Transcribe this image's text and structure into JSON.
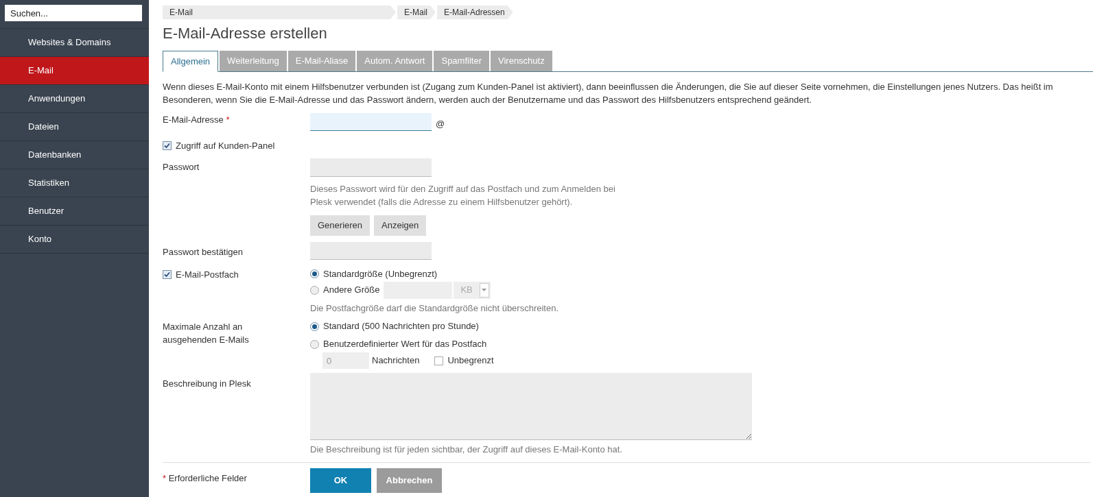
{
  "search": {
    "placeholder": "Suchen..."
  },
  "sidebar": {
    "items": [
      {
        "label": "Websites & Domains",
        "selected": false
      },
      {
        "label": "E-Mail",
        "selected": true
      },
      {
        "label": "Anwendungen",
        "selected": false
      },
      {
        "label": "Dateien",
        "selected": false
      },
      {
        "label": "Datenbanken",
        "selected": false
      },
      {
        "label": "Statistiken",
        "selected": false
      },
      {
        "label": "Benutzer",
        "selected": false
      },
      {
        "label": "Konto",
        "selected": false
      }
    ]
  },
  "breadcrumbs": [
    "E-Mail",
    "E-Mail",
    "E-Mail-Adressen"
  ],
  "title": "E-Mail-Adresse erstellen",
  "tabs": [
    {
      "label": "Allgemein",
      "selected": true
    },
    {
      "label": "Weiterleitung",
      "selected": false
    },
    {
      "label": "E-Mail-Aliase",
      "selected": false
    },
    {
      "label": "Autom. Antwort",
      "selected": false
    },
    {
      "label": "Spamfilter",
      "selected": false
    },
    {
      "label": "Virenschutz",
      "selected": false
    }
  ],
  "intro": "Wenn dieses E-Mail-Konto mit einem Hilfsbenutzer verbunden ist (Zugang zum Kunden-Panel ist aktiviert), dann beeinflussen die Änderungen, die Sie auf dieser Seite vornehmen, die Einstellungen jenes Nutzers. Das heißt im Besonderen, wenn Sie die E-Mail-Adresse und das Passwort ändern, werden auch der Benutzername und das Passwort des Hilfsbenutzers entsprechend geändert.",
  "form": {
    "email": {
      "label": "E-Mail-Adresse",
      "required_mark": "*",
      "suffix": "@"
    },
    "panel_access": {
      "label": "Zugriff auf Kunden-Panel",
      "checked": true
    },
    "password": {
      "label": "Passwort",
      "hint": "Dieses Passwort wird für den Zugriff auf das Postfach und zum Anmelden bei Plesk verwendet (falls die Adresse zu einem Hilfsbenutzer gehört).",
      "buttons": [
        "Generieren",
        "Anzeigen"
      ]
    },
    "password_confirm": {
      "label": "Passwort bestätigen"
    },
    "mailbox": {
      "label": "E-Mail-Postfach",
      "checked": true,
      "options": [
        {
          "label": "Standardgröße (Unbegrenzt)",
          "selected": true
        },
        {
          "label": "Andere Größe",
          "selected": false
        }
      ],
      "size_unit": "KB",
      "hint": "Die Postfachgröße darf die Standardgröße nicht überschreiten."
    },
    "outgoing": {
      "label": "Maximale Anzahl an ausgehenden E-Mails",
      "options": [
        {
          "label": "Standard (500 Nachrichten pro Stunde)",
          "selected": true
        },
        {
          "label": "Benutzerdefinierter Wert für das Postfach",
          "selected": false
        }
      ],
      "custom_value": "0",
      "custom_unit": "Nachrichten",
      "unlimited": {
        "label": "Unbegrenzt",
        "checked": false
      }
    },
    "description": {
      "label": "Beschreibung in Plesk",
      "hint": "Die Beschreibung ist für jeden sichtbar, der Zugriff auf dieses E-Mail-Konto hat."
    }
  },
  "footer": {
    "required_mark": "*",
    "required_note": "Erforderliche Felder",
    "buttons": [
      {
        "label": "OK",
        "kind": "primary"
      },
      {
        "label": "Abbrechen",
        "kind": "secondary"
      }
    ]
  }
}
